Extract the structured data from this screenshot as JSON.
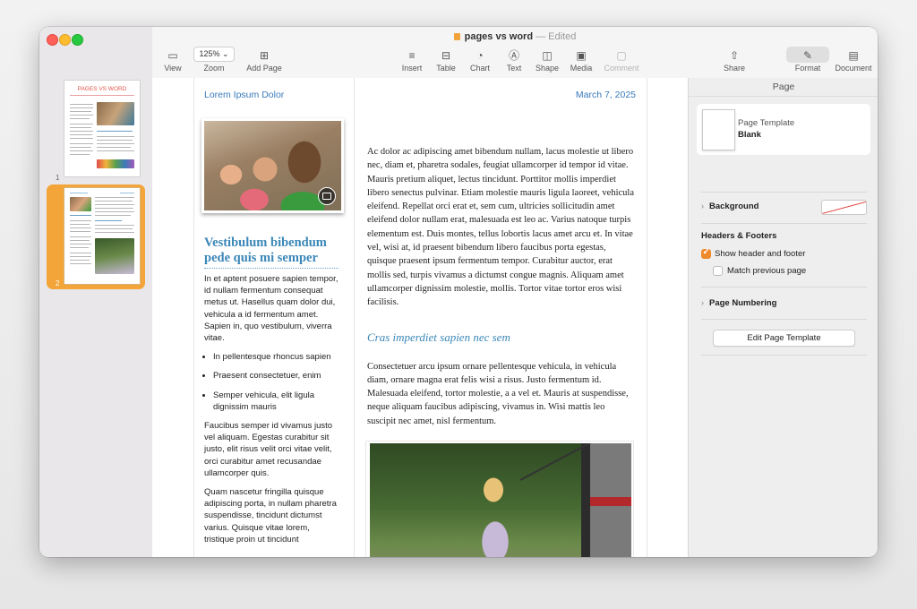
{
  "window": {
    "title": "pages vs word",
    "separator": "—",
    "status": "Edited"
  },
  "toolbar": {
    "view": "View",
    "zoom_value": "125%",
    "zoom": "Zoom",
    "add_page": "Add Page",
    "insert": "Insert",
    "table": "Table",
    "chart": "Chart",
    "text": "Text",
    "shape": "Shape",
    "media": "Media",
    "comment": "Comment",
    "share": "Share",
    "format": "Format",
    "document": "Document"
  },
  "sidebar": {
    "pages": [
      {
        "number": "1",
        "thumb_title": "PAGES VS WORD"
      },
      {
        "number": "2"
      }
    ]
  },
  "doc": {
    "header_left": "Lorem Ipsum Dolor",
    "header_right": "March 7, 2025",
    "left_heading": "Vestibulum bibendum pede quis mi semper",
    "left_p1": "In et aptent posuere sapien tempor, id nullam fermentum consequat metus ut. Hasellus quam dolor dui, vehicula a id fermentum amet. Sapien in, quo vestibulum, viverra vitae.",
    "bullets": [
      "In pellentesque rhoncus sapien",
      "Praesent consectetuer, enim",
      "Semper vehicula, elit ligula dignissim mauris"
    ],
    "left_p2": "Faucibus semper id vivamus justo vel aliquam. Egestas curabitur sit justo, elit risus velit orci vitae velit, orci curabitur amet recusandae ullamcorper quis.",
    "left_p3": "Quam nascetur fringilla quisque adipiscing porta, in nullam pharetra suspendisse, tincidunt dictumst varius. Quisque vitae lorem, tristique proin ut tincidunt",
    "right_p1": "Ac dolor ac adipiscing amet bibendum nullam, lacus molestie ut libero nec, diam et, pharetra sodales, feugiat ullamcorper id tempor id vitae. Mauris pretium aliquet, lectus tincidunt. Porttitor mollis imperdiet libero senectus pulvinar. Etiam molestie mauris ligula laoreet, vehicula eleifend. Repellat orci erat et, sem cum, ultricies sollicitudin amet eleifend dolor nullam erat, malesuada est leo ac. Varius natoque turpis elementum est. Duis montes, tellus lobortis lacus amet arcu et. In vitae vel, wisi at, id praesent bibendum libero faucibus porta egestas, quisque praesent ipsum fermentum tempor. Curabitur auctor, erat mollis sed, turpis vivamus a dictumst congue magnis. Aliquam amet ullamcorper dignissim molestie, mollis. Tortor vitae tortor eros wisi facilisis.",
    "right_heading": "Cras imperdiet sapien nec sem",
    "right_p2": "Consectetuer arcu ipsum ornare pellentesque vehicula, in vehicula diam, ornare magna erat felis wisi a risus. Justo fermentum id. Malesuada eleifend, tortor molestie, a a vel et. Mauris at suspendisse, neque aliquam faucibus adipiscing, vivamus in. Wisi mattis leo suscipit nec amet, nisl fermentum."
  },
  "inspector": {
    "title": "Page",
    "template_label": "Page Template",
    "template_name": "Blank",
    "background": "Background",
    "headers_footers": "Headers & Footers",
    "show_header_footer": "Show header and footer",
    "show_header_footer_checked": true,
    "match_previous": "Match previous page",
    "match_previous_checked": false,
    "page_numbering": "Page Numbering",
    "edit_template": "Edit Page Template"
  },
  "colors": {
    "accent_orange": "#f3a53a",
    "doc_blue": "#3b87b8",
    "checkbox_orange": "#f0892c"
  }
}
